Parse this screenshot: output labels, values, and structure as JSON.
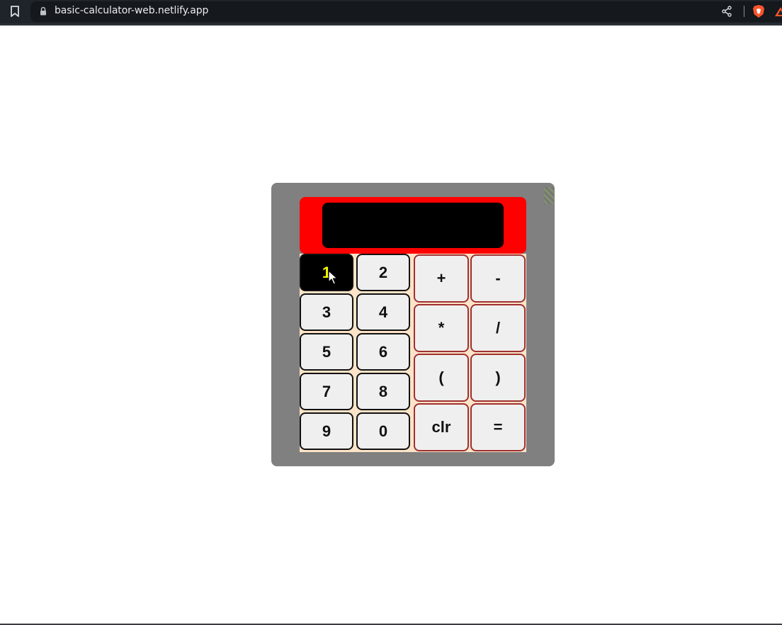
{
  "browser": {
    "url": "basic-calculator-web.netlify.app"
  },
  "calculator": {
    "display": "",
    "number_buttons": [
      "1",
      "2",
      "3",
      "4",
      "5",
      "6",
      "7",
      "8",
      "9",
      "0"
    ],
    "operator_buttons": [
      "+",
      "-",
      "*",
      "/",
      "(",
      ")",
      "clr",
      "="
    ],
    "active_button": "1"
  },
  "colors": {
    "calc_body": "#808080",
    "display_frame": "#ff0000",
    "display_screen": "#000000",
    "keypad_background": "#fde4c8",
    "button_face": "#efefef",
    "active_button_bg": "#000000",
    "active_button_text": "#f5f500",
    "operator_border": "#a03030"
  }
}
